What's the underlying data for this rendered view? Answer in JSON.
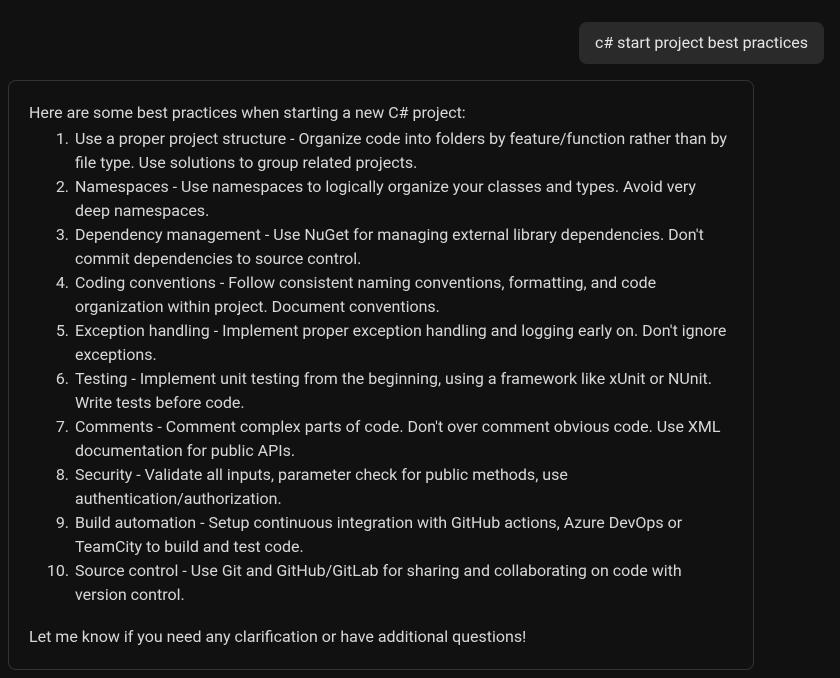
{
  "user_message": "c# start project best practices",
  "assistant": {
    "intro": "Here are some best practices when starting a new C# project:",
    "items": [
      "Use a proper project structure - Organize code into folders by feature/function rather than by file type. Use solutions to group related projects.",
      "Namespaces - Use namespaces to logically organize your classes and types. Avoid very deep namespaces.",
      "Dependency management - Use NuGet for managing external library dependencies. Don't commit dependencies to source control.",
      "Coding conventions - Follow consistent naming conventions, formatting, and code organization within project. Document conventions.",
      "Exception handling - Implement proper exception handling and logging early on. Don't ignore exceptions.",
      "Testing - Implement unit testing from the beginning, using a framework like xUnit or NUnit. Write tests before code.",
      "Comments - Comment complex parts of code. Don't over comment obvious code. Use XML documentation for public APIs.",
      "Security - Validate all inputs, parameter check for public methods, use authentication/authorization.",
      "Build automation - Setup continuous integration with GitHub actions, Azure DevOps or TeamCity to build and test code.",
      "Source control - Use Git and GitHub/GitLab for sharing and collaborating on code with version control."
    ],
    "outro": "Let me know if you need any clarification or have additional questions!"
  }
}
